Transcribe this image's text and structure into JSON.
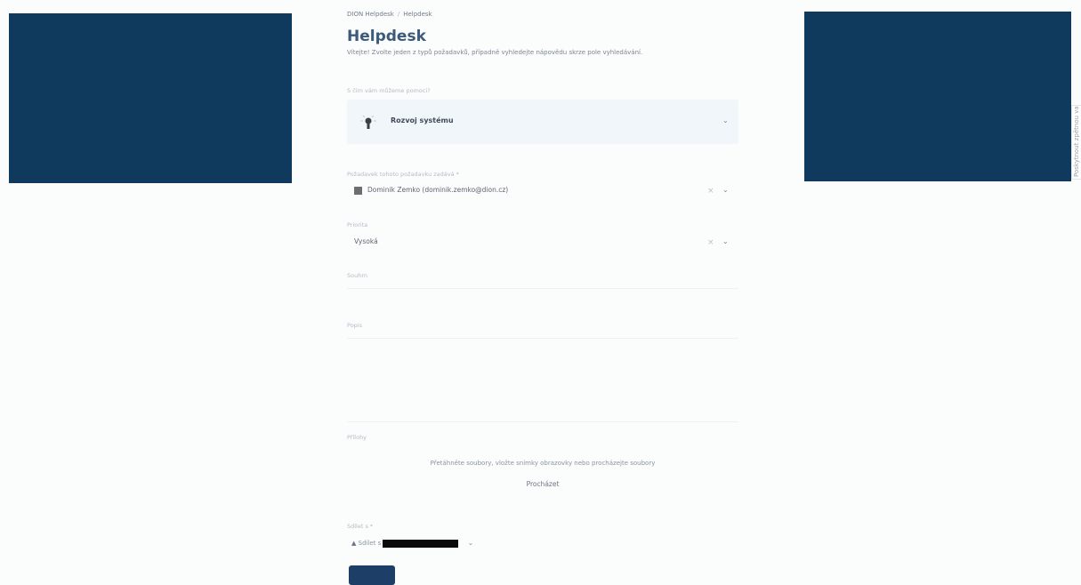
{
  "breadcrumb": {
    "root": "DION Helpdesk",
    "separator": "/",
    "current": "Helpdesk"
  },
  "page": {
    "title": "Helpdesk",
    "intro": "Vítejte! Zvolte jeden z typů požadavků, případně vyhledejte nápovědu skrze pole vyhledávání."
  },
  "form": {
    "request_type": {
      "label": "S čím vám můžeme pomoci?",
      "value": "Rozvoj systému",
      "icon": "lightbulb-icon"
    },
    "raise_on_behalf": {
      "label": "Požadavek tohoto požadavku zadává *",
      "value": "Dominik Zemko (dominik.zemko@dion.cz)",
      "clear_icon": "×"
    },
    "priority": {
      "label": "Priorita",
      "value": "Vysoká",
      "clear_icon": "×"
    },
    "summary": {
      "label": "Souhrn"
    },
    "description": {
      "label": "Popis"
    },
    "attachment": {
      "label": "Přílohy",
      "drop_text": "Přetáhněte soubory, vložte snímky obrazovky nebo procházejte soubory",
      "browse_label": "Procházet"
    },
    "share": {
      "label": "Sdílet s *",
      "value": "Sdílet s"
    },
    "submit_label": ""
  },
  "feedback_tab": {
    "label": "Poskytnout zpětnou vazbu"
  },
  "colors": {
    "banner": "#0f3a5e",
    "title": "#3c5a7c",
    "request_type_bg": "#f1f6fa",
    "submit": "#1d3e66"
  }
}
